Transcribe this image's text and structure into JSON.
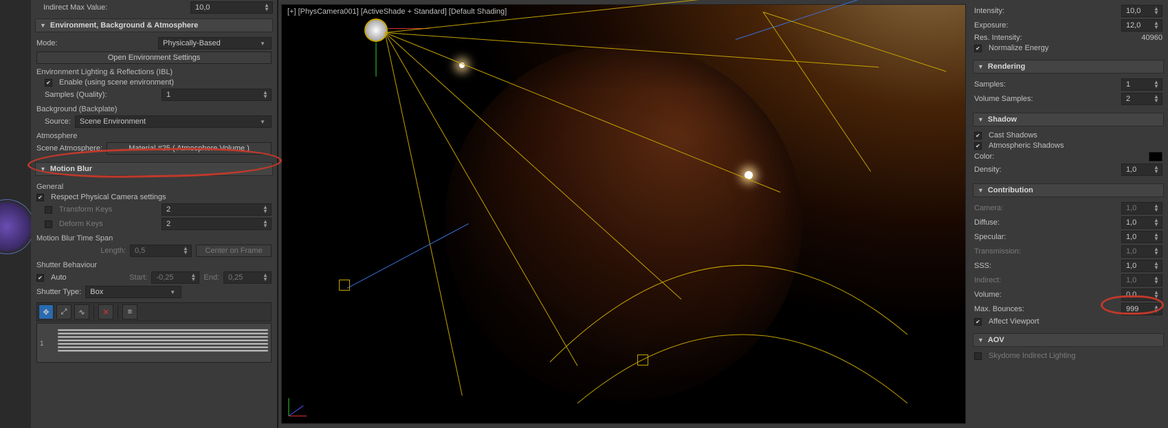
{
  "left": {
    "indirect_max_label": "Indirect Max Value:",
    "indirect_max_value": "10,0",
    "env_header": "Environment, Background & Atmosphere",
    "mode_label": "Mode:",
    "mode_value": "Physically-Based",
    "open_env_btn": "Open Environment Settings",
    "ibl_label": "Environment Lighting & Reflections (IBL)",
    "enable_ibl_label": "Enable (using scene environment)",
    "samples_q_label": "Samples (Quality):",
    "samples_q_value": "1",
    "backplate_label": "Background (Backplate)",
    "source_label": "Source:",
    "source_value": "Scene Environment",
    "atmos_label": "Atmosphere",
    "scene_atmos_label": "Scene Atmosphere:",
    "scene_atmos_value": "Material #25  ( Atmosphere Volume )",
    "motion_blur_header": "Motion Blur",
    "general_label": "General",
    "respect_cam_label": "Respect Physical Camera settings",
    "transform_keys_label": "Transform Keys",
    "transform_keys_value": "2",
    "deform_keys_label": "Deform Keys",
    "deform_keys_value": "2",
    "mb_timespan_label": "Motion Blur Time Span",
    "length_label": "Length:",
    "length_value": "0,5",
    "center_btn": "Center on Frame",
    "shutter_beh_label": "Shutter Behaviour",
    "auto_label": "Auto",
    "start_label": "Start:",
    "start_value": "-0,25",
    "end_label": "End:",
    "end_value": "0,25",
    "shutter_type_label": "Shutter Type:",
    "shutter_type_value": "Box",
    "curve_row": "1"
  },
  "viewport": {
    "label": "[+] [PhysCamera001] [ActiveShade + Standard] [Default Shading]"
  },
  "right": {
    "intensity_label": "Intensity:",
    "intensity_value": "10,0",
    "exposure_label": "Exposure:",
    "exposure_value": "12,0",
    "res_int_label": "Res. Intensity:",
    "res_int_value": "40960",
    "normalize_label": "Normalize Energy",
    "rendering_header": "Rendering",
    "samples_label": "Samples:",
    "samples_value": "1",
    "vol_samples_label": "Volume Samples:",
    "vol_samples_value": "2",
    "shadow_header": "Shadow",
    "cast_label": "Cast Shadows",
    "atmo_shadow_label": "Atmospheric Shadows",
    "color_label": "Color:",
    "density_label": "Density:",
    "density_value": "1,0",
    "contrib_header": "Contribution",
    "camera_label": "Camera:",
    "camera_value": "1,0",
    "diffuse_label": "Diffuse:",
    "diffuse_value": "1,0",
    "specular_label": "Specular:",
    "specular_value": "1,0",
    "trans_label": "Transmission:",
    "trans_value": "1,0",
    "sss_label": "SSS:",
    "sss_value": "1,0",
    "indirect_label": "Indirect:",
    "indirect_value": "1,0",
    "volume_label": "Volume:",
    "volume_value": "0,0",
    "maxb_label": "Max. Bounces:",
    "maxb_value": "999",
    "affect_vp_label": "Affect Viewport",
    "aov_header": "AOV",
    "skydome_label": "Skydome Indirect Lighting"
  }
}
